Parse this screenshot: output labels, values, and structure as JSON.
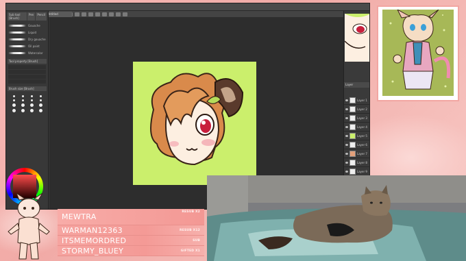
{
  "colors": {
    "stream_pink": "#f4b7b4",
    "app_dark": "#3a3a3a",
    "artboard_green": "#cbef6c",
    "event_pink": "#f49a96"
  },
  "app": {
    "document_tab": "Untitled",
    "left_panel": {
      "tabs": [
        "Sub tool [Brush]",
        "Pen",
        "Pencil"
      ],
      "brushes": [
        "Gouache",
        "Liquid",
        "Dry gouache",
        "Oil paint",
        "Watercolor"
      ],
      "tool_property_header": "Tool property [Brush]",
      "brush_size_header": "Brush size [Brush]"
    },
    "right_panel": {
      "layer_header": "Layer",
      "layers": [
        "Layer 1",
        "Layer 2",
        "Layer 3",
        "Layer 4",
        "Layer 5",
        "Layer 6",
        "Layer 7",
        "Layer 8",
        "Layer 9"
      ]
    }
  },
  "events": [
    {
      "name": "MEWTRA",
      "tag": "RESUB X2"
    },
    {
      "name": "WARMAN12363",
      "tag": "RESUB X12"
    },
    {
      "name": "ITSMEMORDRED",
      "tag": "SUB"
    },
    {
      "name": "STORMY_BLUEY",
      "tag": "GIFTED X1"
    }
  ],
  "icons": [
    "brush-icon",
    "eye-icon",
    "color-wheel-icon"
  ]
}
